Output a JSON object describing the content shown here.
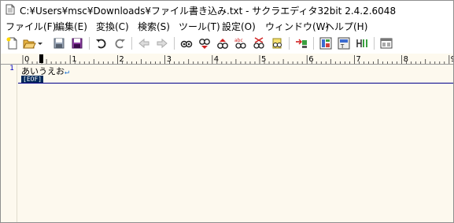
{
  "window": {
    "title": "C:¥Users¥msc¥Downloads¥ファイル書き込み.txt - サクラエディタ32bit 2.4.2.6048"
  },
  "menu": [
    {
      "id": "file",
      "label": "ファイル(F)"
    },
    {
      "id": "edit",
      "label": "編集(E)"
    },
    {
      "id": "convert",
      "label": "変換(C)"
    },
    {
      "id": "search",
      "label": "検索(S)"
    },
    {
      "id": "tools",
      "label": "ツール(T)"
    },
    {
      "id": "settings",
      "label": "設定(O)"
    },
    {
      "id": "window",
      "label": "ウィンドウ(W)"
    },
    {
      "id": "help",
      "label": "ヘルプ(H)"
    }
  ],
  "toolbar": {
    "icons": [
      "new-file-icon",
      "open-folder-icon",
      "dropdown-arrow-icon",
      "save-icon",
      "save-all-icon",
      "undo-icon",
      "redo-icon",
      "back-icon",
      "forward-icon",
      "find-icon",
      "find-next-icon",
      "find-prev-icon",
      "find-grep-icon",
      "replace-icon",
      "bookmark-icon",
      "jump-icon",
      "outline-icon",
      "settings-icon",
      "type-settings-icon",
      "window-list-icon"
    ]
  },
  "ruler": {
    "numbers": [
      "0",
      "1",
      "2",
      "3",
      "4",
      "5",
      "6",
      "7",
      "8",
      "9"
    ]
  },
  "editor": {
    "line_number": "1",
    "line_text": "あいうえお",
    "newline_mark": "↵",
    "eof_label": "[EOF]"
  },
  "colors": {
    "editor_bg": "#fdf9ee",
    "line_number": "#0000c0",
    "eof_bg": "#00285a",
    "cursor_line": "#00008b"
  }
}
